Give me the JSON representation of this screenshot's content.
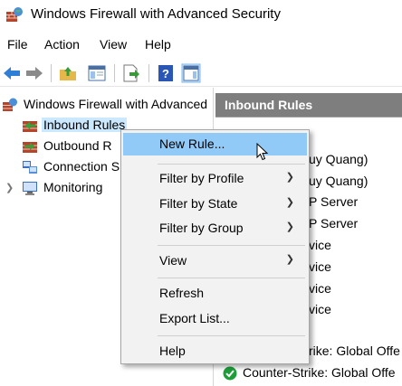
{
  "window": {
    "title": "Windows Firewall with Advanced Security"
  },
  "menubar": {
    "items": [
      "File",
      "Action",
      "View",
      "Help"
    ]
  },
  "tree": {
    "root_label": "Windows Firewall with Advanced",
    "items": [
      {
        "label": "Inbound Rules",
        "selected": true
      },
      {
        "label": "Outbound R"
      },
      {
        "label": "Connection S"
      },
      {
        "label": "Monitoring"
      }
    ]
  },
  "right_panel": {
    "header": "Inbound Rules",
    "rows": [
      {
        "text": "uy Quang)"
      },
      {
        "text": "uy Quang)"
      },
      {
        "text": "P Server"
      },
      {
        "text": "P Server"
      },
      {
        "text": "vice"
      },
      {
        "text": "vice"
      },
      {
        "text": "vice"
      },
      {
        "text": "vice"
      },
      {
        "text": "rike: Global Offe"
      },
      {
        "text": "Counter-Strike: Global Offe"
      }
    ]
  },
  "context_menu": {
    "items": {
      "new_rule": "New Rule...",
      "filter_profile": "Filter by Profile",
      "filter_state": "Filter by State",
      "filter_group": "Filter by Group",
      "view": "View",
      "refresh": "Refresh",
      "export": "Export List...",
      "help": "Help"
    }
  },
  "colors": {
    "accent_hover": "#91c9f7",
    "tree_selection": "#cce8ff",
    "panel_header": "#7e7e7e",
    "ok_green": "#1e9e3a"
  },
  "icons": {
    "app": "firewall-brick-globe-icon",
    "back": "arrow-back-icon",
    "forward": "arrow-forward-icon",
    "up": "folder-up-icon",
    "show_hide": "show-hide-console-tree-icon",
    "export": "export-list-icon",
    "help": "help-icon",
    "action_pane": "show-action-pane-icon"
  }
}
